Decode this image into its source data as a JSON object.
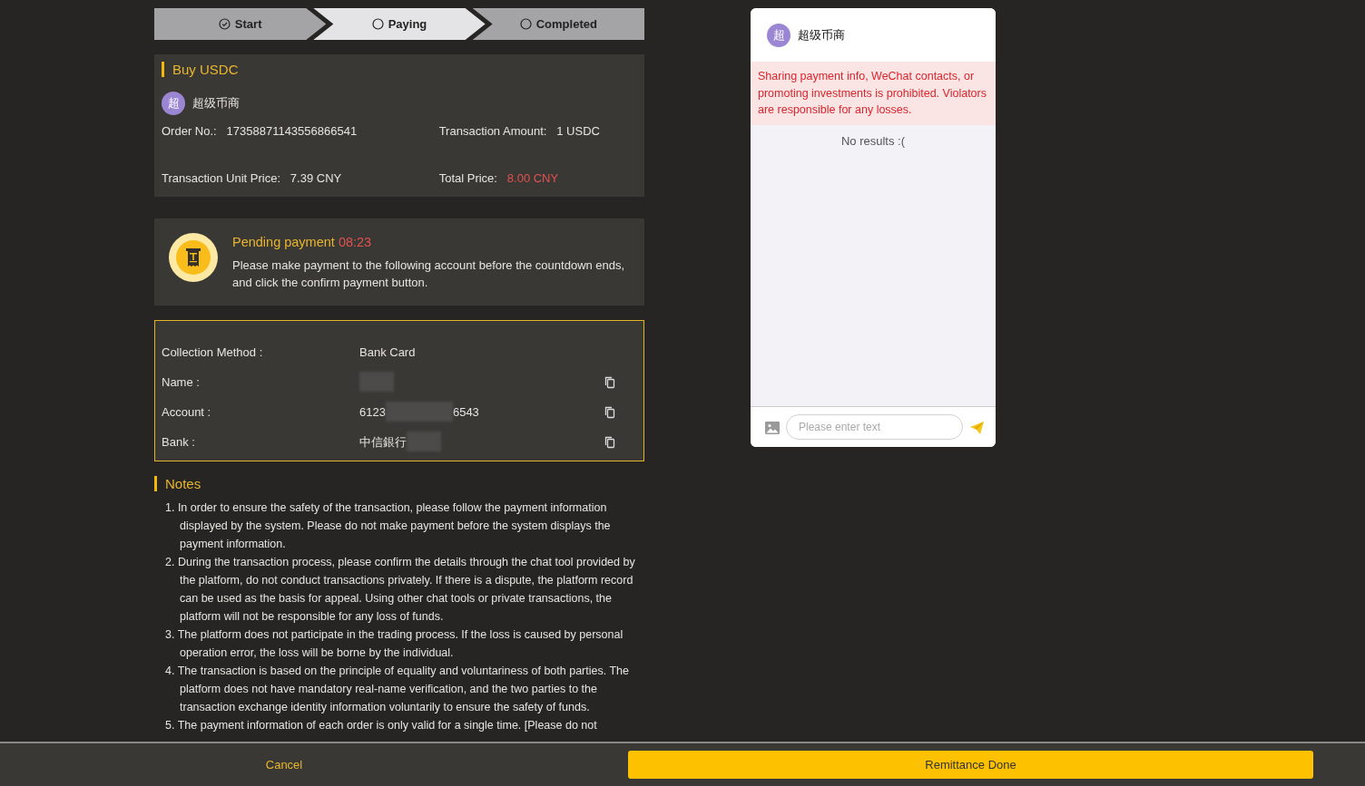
{
  "steps": [
    {
      "label": "Start",
      "checked": true,
      "selected": false
    },
    {
      "label": "Paying",
      "checked": false,
      "selected": true
    },
    {
      "label": "Completed",
      "checked": false,
      "selected": false
    }
  ],
  "order": {
    "title": "Buy USDC",
    "merchant": {
      "avatar": "超",
      "name": "超级币商"
    },
    "fields": [
      {
        "label": "Order No.:",
        "value": "17358871143556866541",
        "highlight": false
      },
      {
        "label": "Transaction Amount:",
        "value": "1 USDC",
        "highlight": false
      },
      {
        "label": "Transaction Unit Price:",
        "value": "7.39 CNY",
        "highlight": false
      },
      {
        "label": "Total Price:",
        "value": "8.00 CNY",
        "highlight": true
      }
    ]
  },
  "pending": {
    "title": "Pending payment",
    "countdown": "08:23",
    "message": "Please make payment to the following account before the countdown ends, and click the confirm payment button."
  },
  "collection": [
    {
      "label": "Collection Method :",
      "segments": [
        {
          "kind": "text",
          "text": "Bank Card"
        }
      ],
      "copy": false
    },
    {
      "label": "Name :",
      "segments": [
        {
          "kind": "blur"
        }
      ],
      "copy": true
    },
    {
      "label": "Account :",
      "segments": [
        {
          "kind": "text",
          "text": "6123"
        },
        {
          "kind": "blur"
        },
        {
          "kind": "text",
          "text": "6543"
        }
      ],
      "copy": true
    },
    {
      "label": "Bank :",
      "segments": [
        {
          "kind": "text",
          "text": "中信銀行"
        },
        {
          "kind": "blur"
        }
      ],
      "copy": true
    }
  ],
  "notes": {
    "title": "Notes",
    "items": [
      "1. In order to ensure the safety of the transaction, please follow the payment information displayed by the system. Please do not make payment before the system displays the payment information.",
      "2. During the transaction process, please confirm the details through the chat tool provided by the platform, do not conduct transactions privately. If there is a dispute, the platform record can be used as the basis for appeal. Using other chat tools or private transactions, the platform will not be responsible for any loss of funds.",
      "3. The platform does not participate in the trading process. If the loss is caused by personal operation error, the loss will be borne by the individual.",
      "4. The transaction is based on the principle of equality and voluntariness of both parties. The platform does not have mandatory real-name verification, and the two parties to the transaction exchange identity information voluntarily to ensure the safety of funds.",
      "5. The payment information of each order is only valid for a single time. [Please do not"
    ]
  },
  "chat": {
    "avatar": "超",
    "name": "超级币商",
    "warning": "Sharing payment info, WeChat contacts, or promoting investments is prohibited. Violators are responsible for any losses.",
    "empty": "No results :(",
    "input": {
      "placeholder": "Please enter text"
    }
  },
  "buttons": {
    "cancel": "Cancel",
    "confirm": "Remittance Done"
  }
}
